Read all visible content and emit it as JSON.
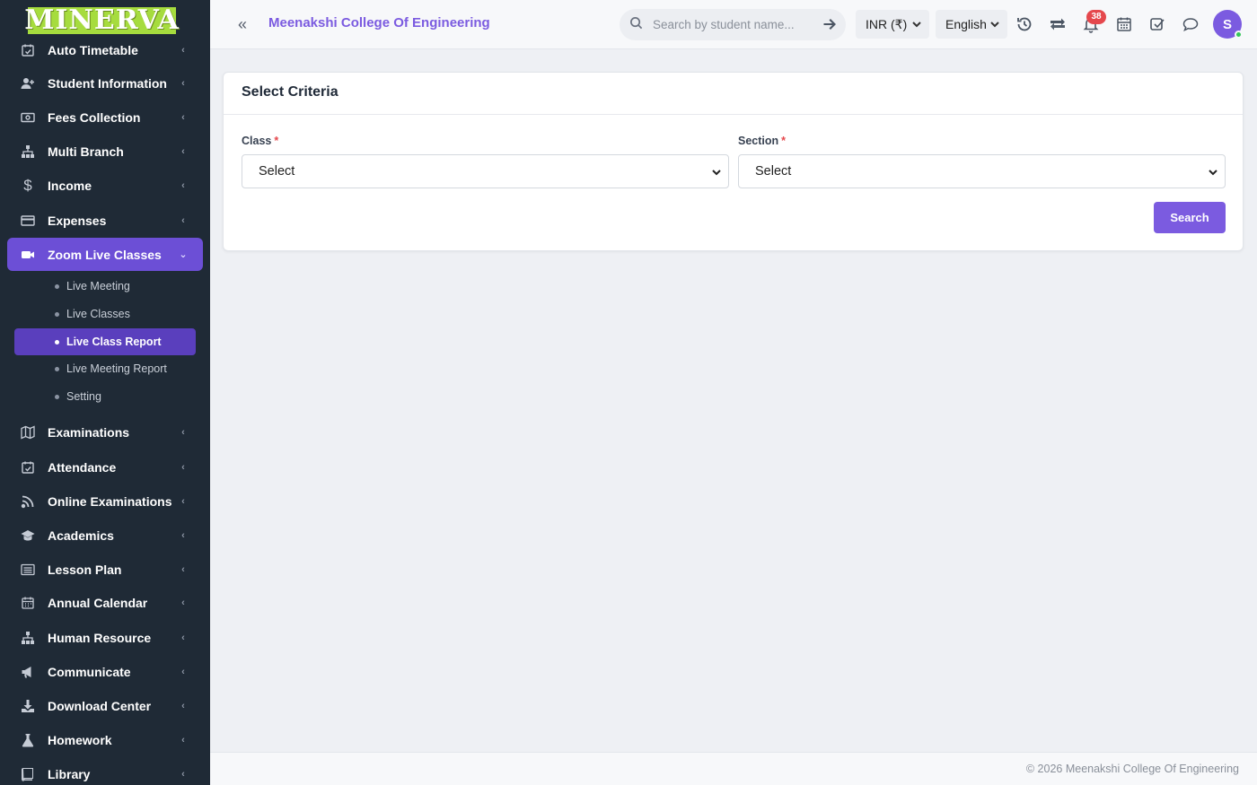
{
  "brand": {
    "logo_text": "MINERVA"
  },
  "header": {
    "title": "Meenakshi College Of Engineering",
    "search_placeholder": "Search by student name...",
    "currency": "INR (₹)",
    "language": "English",
    "notification_count": "38",
    "avatar_initial": "S"
  },
  "sidebar": {
    "items": [
      {
        "label": "Auto Timetable",
        "icon": "calendar-check-icon"
      },
      {
        "label": "Student Information",
        "icon": "user-plus-icon"
      },
      {
        "label": "Fees Collection",
        "icon": "money-icon"
      },
      {
        "label": "Multi Branch",
        "icon": "sitemap-icon"
      },
      {
        "label": "Income",
        "icon": "dollar-icon"
      },
      {
        "label": "Expenses",
        "icon": "credit-card-icon"
      },
      {
        "label": "Zoom Live Classes",
        "icon": "video-icon"
      },
      {
        "label": "Examinations",
        "icon": "map-icon"
      },
      {
        "label": "Attendance",
        "icon": "calendar-check-icon"
      },
      {
        "label": "Online Examinations",
        "icon": "rss-icon"
      },
      {
        "label": "Academics",
        "icon": "graduation-cap-icon"
      },
      {
        "label": "Lesson Plan",
        "icon": "list-icon"
      },
      {
        "label": "Annual Calendar",
        "icon": "calendar-icon"
      },
      {
        "label": "Human Resource",
        "icon": "sitemap-icon"
      },
      {
        "label": "Communicate",
        "icon": "bullhorn-icon"
      },
      {
        "label": "Download Center",
        "icon": "download-icon"
      },
      {
        "label": "Homework",
        "icon": "flask-icon"
      },
      {
        "label": "Library",
        "icon": "book-icon"
      }
    ],
    "sub_items": [
      {
        "label": "Live Meeting"
      },
      {
        "label": "Live Classes"
      },
      {
        "label": "Live Class Report"
      },
      {
        "label": "Live Meeting Report"
      },
      {
        "label": "Setting"
      }
    ],
    "active_item": "Zoom Live Classes",
    "active_sub_item": "Live Class Report"
  },
  "card": {
    "title": "Select Criteria",
    "class_label": "Class",
    "section_label": "Section",
    "required_mark": "*",
    "class_value": "Select",
    "section_value": "Select",
    "search_button": "Search"
  },
  "footer": {
    "text": "© 2026 Meenakshi College Of Engineering"
  },
  "colors": {
    "accent": "#7b5be0",
    "sidebar_bg": "#1f2a36",
    "active_nav": "#6c4fd6",
    "badge": "#e5484d"
  }
}
